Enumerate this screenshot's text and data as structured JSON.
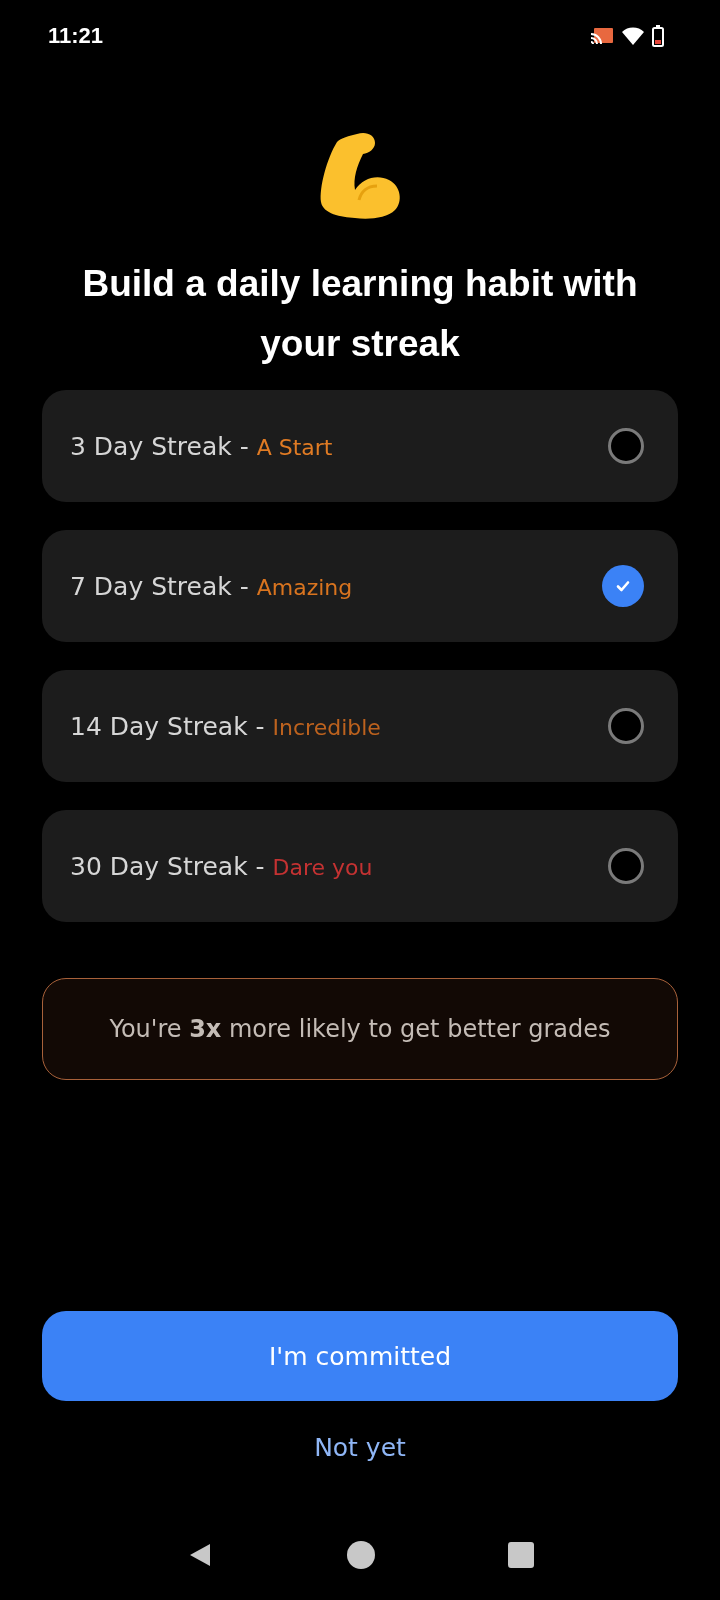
{
  "status_bar": {
    "time": "11:21"
  },
  "title": "Build a daily learning habit with your streak",
  "options": [
    {
      "label": "3 Day Streak - ",
      "tag": "A Start",
      "color": "#e07b24",
      "selected": false
    },
    {
      "label": "7 Day Streak - ",
      "tag": "Amazing",
      "color": "#d9741f",
      "selected": true
    },
    {
      "label": "14 Day Streak - ",
      "tag": "Incredible",
      "color": "#bd621e",
      "selected": false
    },
    {
      "label": "30 Day Streak - ",
      "tag": "Dare you",
      "color": "#c43232",
      "selected": false
    }
  ],
  "info": "You're **3x** more likely to get better grades",
  "primary_button": "I'm committed",
  "secondary_button": "Not yet"
}
